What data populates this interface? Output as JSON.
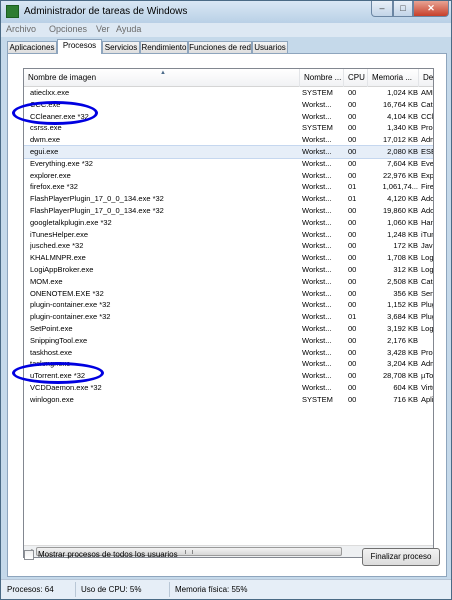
{
  "window": {
    "title": "Administrador de tareas de Windows",
    "controls": {
      "minimize": "–",
      "maximize": "□",
      "close": "✕"
    }
  },
  "menu": [
    "Archivo",
    "Opciones",
    "Ver",
    "Ayuda"
  ],
  "tabs": [
    "Aplicaciones",
    "Procesos",
    "Servicios",
    "Rendimiento",
    "Funciones de red",
    "Usuarios"
  ],
  "active_tab": "Procesos",
  "columns": {
    "name": "Nombre de imagen",
    "user": "Nombre ...",
    "cpu": "CPU",
    "memory": "Memoria ...",
    "desc": "Desc"
  },
  "processes": [
    {
      "name": "atieclxx.exe",
      "user": "SYSTEM",
      "cpu": "00",
      "mem": "1,024 KB",
      "desc": "AMD"
    },
    {
      "name": "CCC.exe",
      "user": "Workst...",
      "cpu": "00",
      "mem": "16,764 KB",
      "desc": "Cata"
    },
    {
      "name": "CCleaner.exe *32",
      "user": "Workst...",
      "cpu": "00",
      "mem": "4,104 KB",
      "desc": "CCle"
    },
    {
      "name": "csrss.exe",
      "user": "SYSTEM",
      "cpu": "00",
      "mem": "1,340 KB",
      "desc": "Proc"
    },
    {
      "name": "dwm.exe",
      "user": "Workst...",
      "cpu": "00",
      "mem": "17,012 KB",
      "desc": "Admi"
    },
    {
      "name": "egui.exe",
      "user": "Workst...",
      "cpu": "00",
      "mem": "2,080 KB",
      "desc": "ESET"
    },
    {
      "name": "Everything.exe *32",
      "user": "Workst...",
      "cpu": "00",
      "mem": "7,604 KB",
      "desc": "Ever"
    },
    {
      "name": "explorer.exe",
      "user": "Workst...",
      "cpu": "00",
      "mem": "22,976 KB",
      "desc": "Explo"
    },
    {
      "name": "firefox.exe *32",
      "user": "Workst...",
      "cpu": "01",
      "mem": "1,061,74...",
      "desc": "Firefo"
    },
    {
      "name": "FlashPlayerPlugin_17_0_0_134.exe *32",
      "user": "Workst...",
      "cpu": "01",
      "mem": "4,120 KB",
      "desc": "Adob"
    },
    {
      "name": "FlashPlayerPlugin_17_0_0_134.exe *32",
      "user": "Workst...",
      "cpu": "00",
      "mem": "19,860 KB",
      "desc": "Adob"
    },
    {
      "name": "googletalkplugin.exe *32",
      "user": "Workst...",
      "cpu": "00",
      "mem": "1,060 KB",
      "desc": "Hang"
    },
    {
      "name": "iTunesHelper.exe",
      "user": "Workst...",
      "cpu": "00",
      "mem": "1,248 KB",
      "desc": "iTune"
    },
    {
      "name": "jusched.exe *32",
      "user": "Workst...",
      "cpu": "00",
      "mem": "172 KB",
      "desc": "Java"
    },
    {
      "name": "KHALMNPR.exe",
      "user": "Workst...",
      "cpu": "00",
      "mem": "1,708 KB",
      "desc": "Logit"
    },
    {
      "name": "LogiAppBroker.exe",
      "user": "Workst...",
      "cpu": "00",
      "mem": "312 KB",
      "desc": "LogiA"
    },
    {
      "name": "MOM.exe",
      "user": "Workst...",
      "cpu": "00",
      "mem": "2,508 KB",
      "desc": "Cata"
    },
    {
      "name": "ONENOTEM.EXE *32",
      "user": "Workst...",
      "cpu": "00",
      "mem": "356 KB",
      "desc": "Send"
    },
    {
      "name": "plugin-container.exe *32",
      "user": "Workst...",
      "cpu": "00",
      "mem": "1,152 KB",
      "desc": "Plugi"
    },
    {
      "name": "plugin-container.exe *32",
      "user": "Workst...",
      "cpu": "01",
      "mem": "3,684 KB",
      "desc": "Plugi"
    },
    {
      "name": "SetPoint.exe",
      "user": "Workst...",
      "cpu": "00",
      "mem": "3,192 KB",
      "desc": "Logit"
    },
    {
      "name": "SnippingTool.exe",
      "user": "Workst...",
      "cpu": "00",
      "mem": "2,176 KB",
      "desc": ""
    },
    {
      "name": "taskhost.exe",
      "user": "Workst...",
      "cpu": "00",
      "mem": "3,428 KB",
      "desc": "Proc"
    },
    {
      "name": "taskmgr.exe",
      "user": "Workst...",
      "cpu": "00",
      "mem": "3,204 KB",
      "desc": "Admi"
    },
    {
      "name": "uTorrent.exe *32",
      "user": "Workst...",
      "cpu": "00",
      "mem": "28,708 KB",
      "desc": "µTorr"
    },
    {
      "name": "VCDDaemon.exe *32",
      "user": "Workst...",
      "cpu": "00",
      "mem": "604 KB",
      "desc": "Virtu"
    },
    {
      "name": "winlogon.exe",
      "user": "SYSTEM",
      "cpu": "00",
      "mem": "716 KB",
      "desc": "Aplica"
    }
  ],
  "selected_process": "egui.exe",
  "show_all_users": {
    "label": "Mostrar procesos de todos los usuarios",
    "checked": false
  },
  "end_process_button": "Finalizar proceso",
  "status": {
    "processes": "Procesos: 64",
    "cpu": "Uso de CPU: 5%",
    "memory": "Memoria física: 55%"
  },
  "colors": {
    "annotation": "#0000e0",
    "selection": "#e6eef8"
  }
}
